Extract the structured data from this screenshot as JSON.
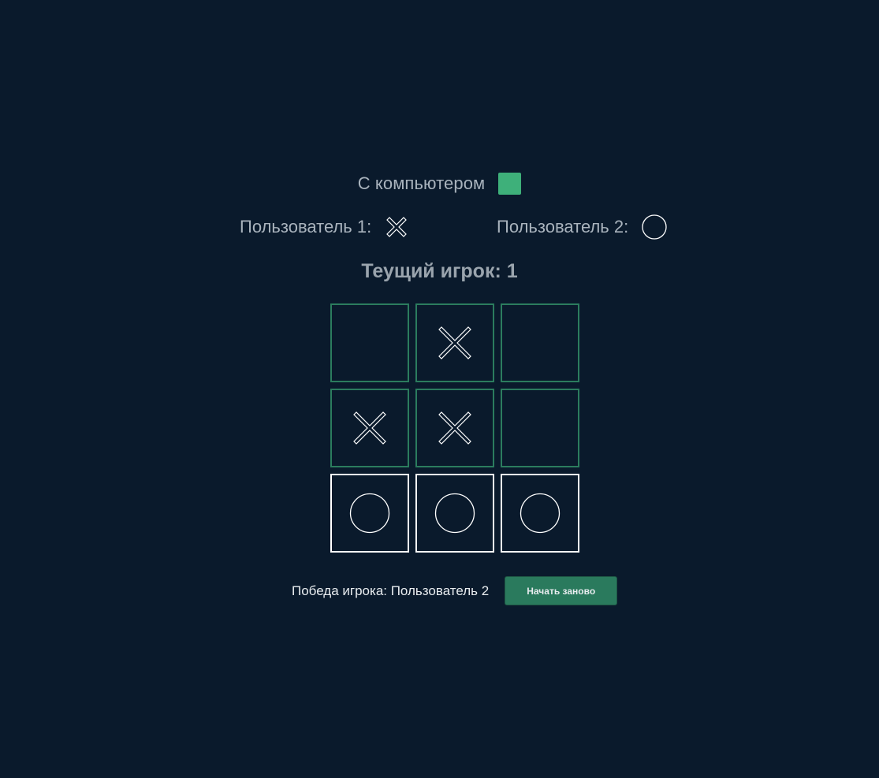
{
  "mode": {
    "label": "С компьютером",
    "toggle_color": "#3eb07a"
  },
  "players": {
    "player1": {
      "label": "Пользователь 1:",
      "symbol": "x-icon"
    },
    "player2": {
      "label": "Пользователь 2:",
      "symbol": "circle-icon"
    }
  },
  "current_player": "Теущий игрок: 1",
  "board": {
    "cells": [
      "",
      "X",
      "",
      "X",
      "X",
      "",
      "O",
      "O",
      "O"
    ],
    "winning_cells": [
      6,
      7,
      8
    ],
    "border_color": "#2b7c5e",
    "win_border_color": "#ffffff"
  },
  "status": {
    "winner_text": "Победа игрока: Пользователь 2",
    "restart_label": "Начать заново"
  }
}
